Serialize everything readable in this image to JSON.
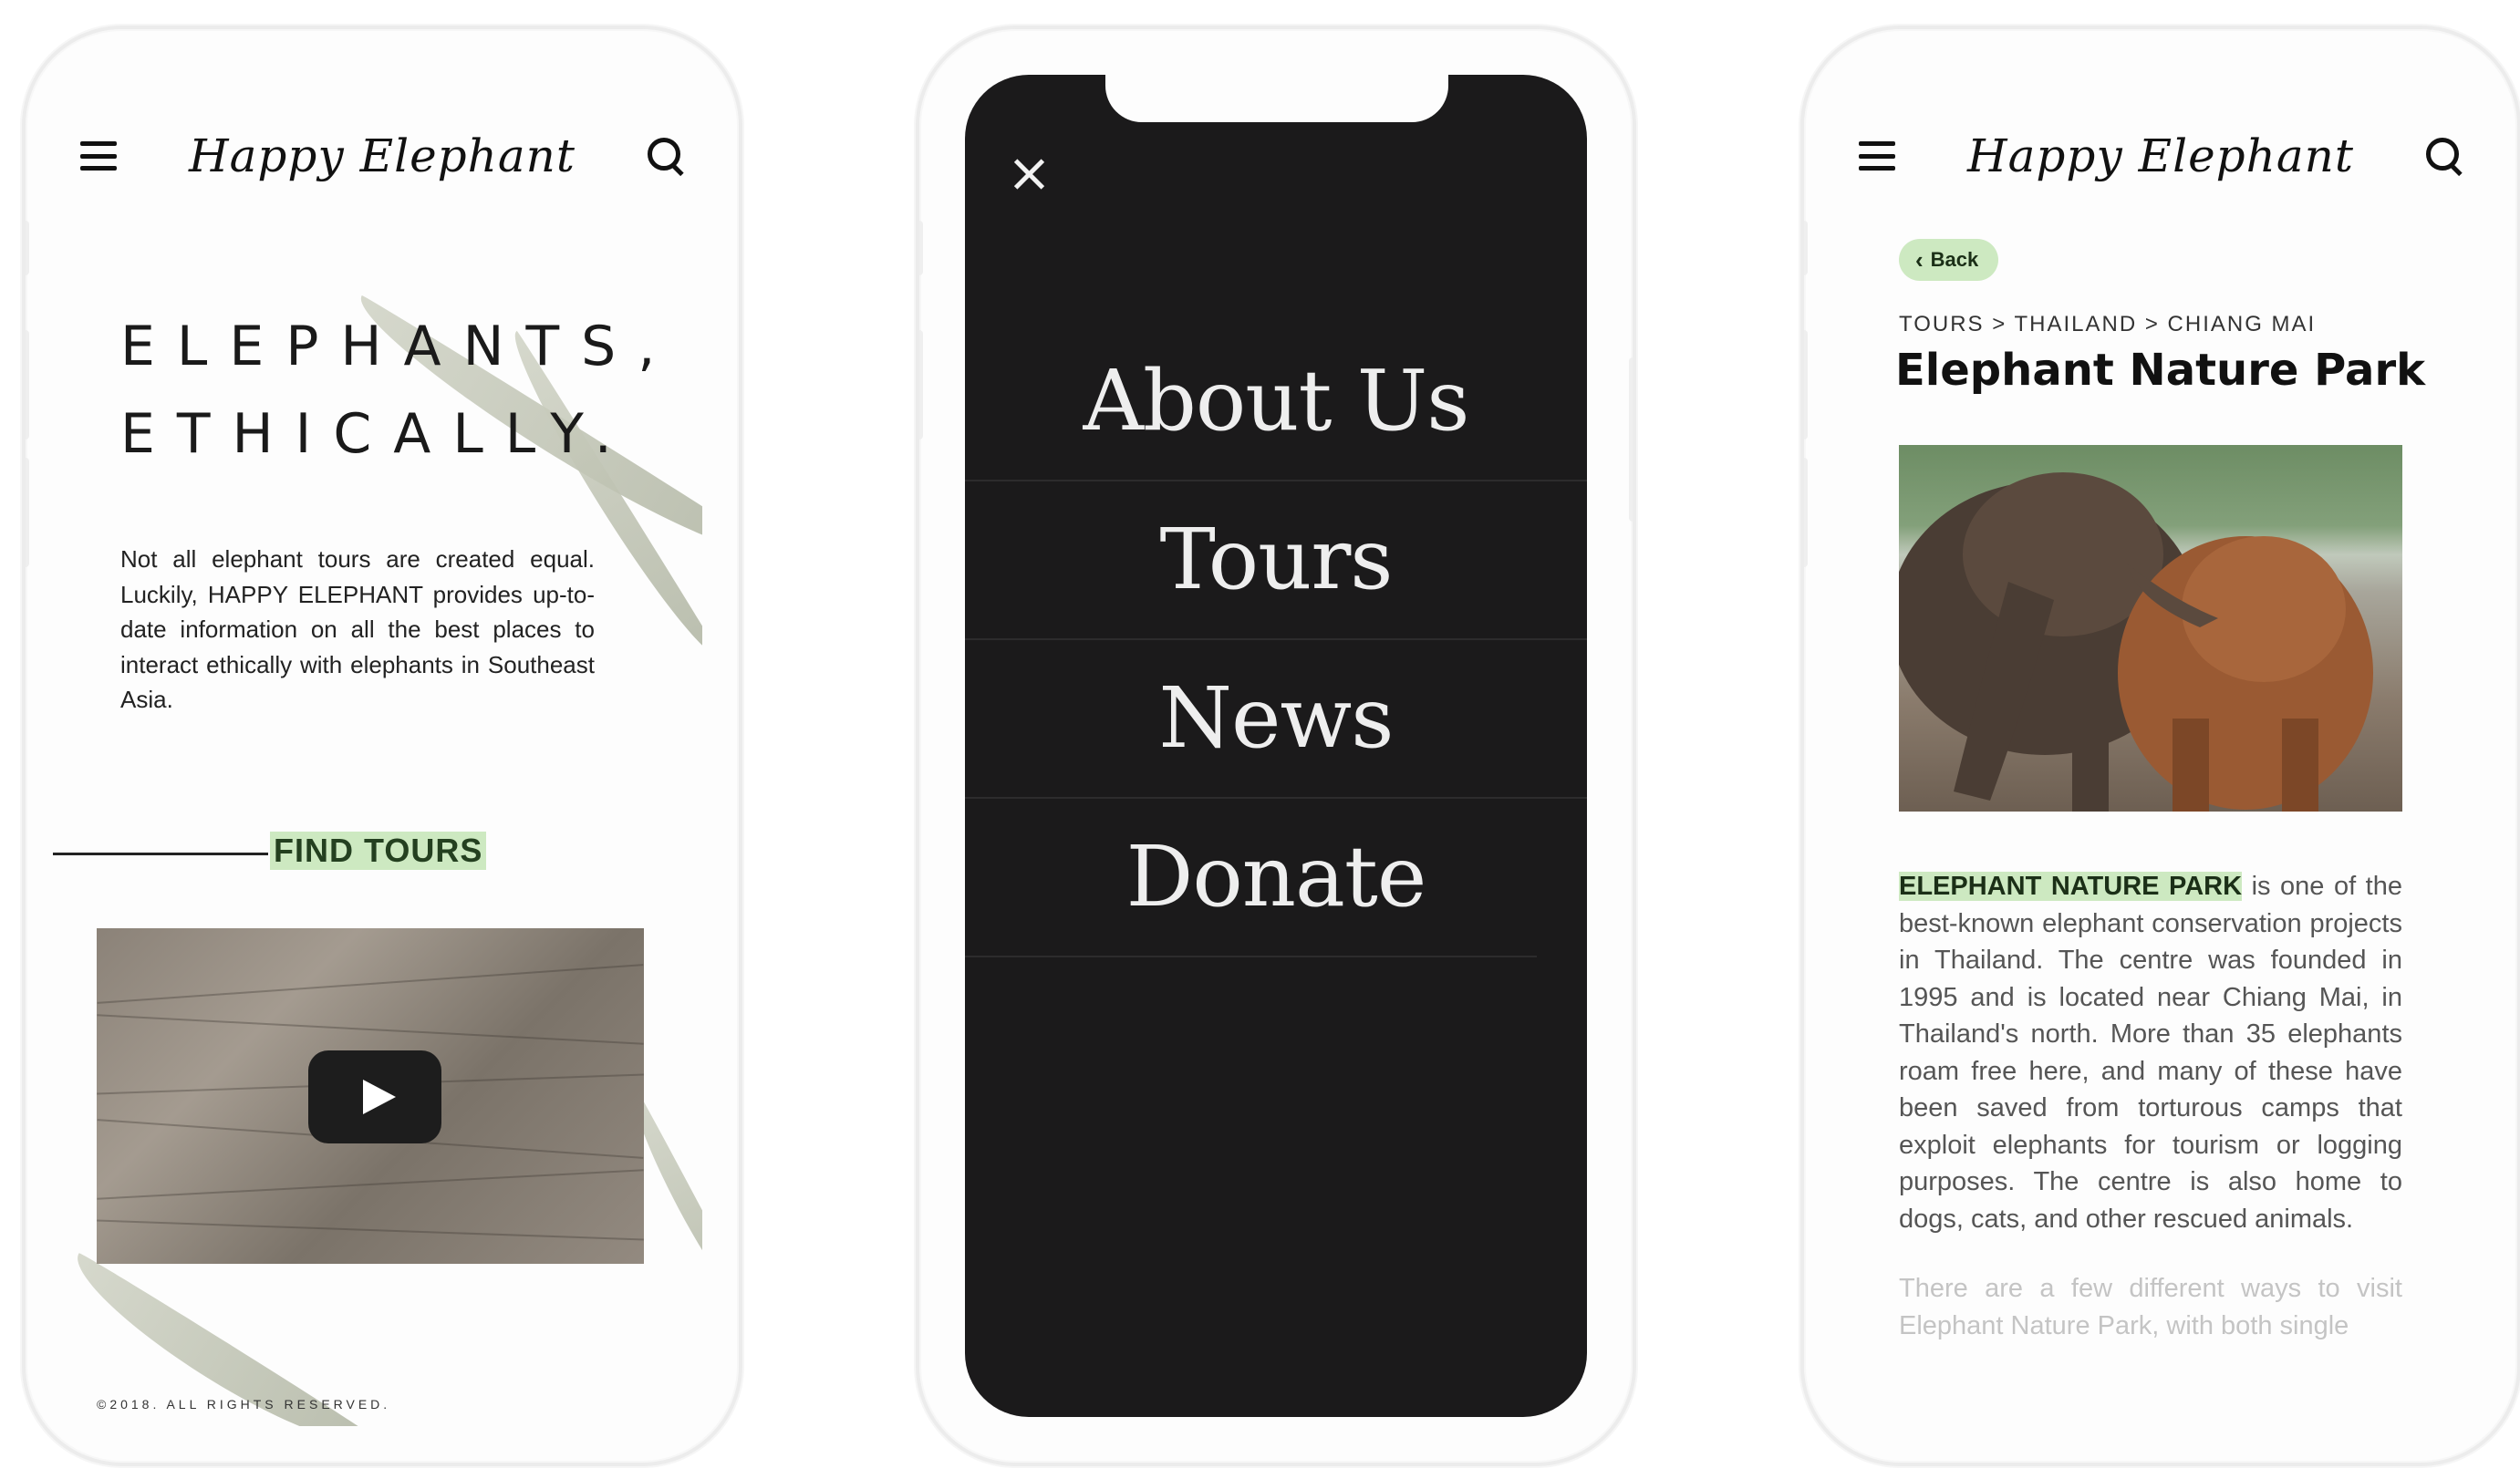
{
  "phone_home": {
    "logo": "Happy Elephant",
    "hero_title_line1": "ELEPHANTS,",
    "hero_title_line2": "ETHICALLY.",
    "intro": "Not all elephant tours are created equal. Luckily, HAPPY ELEPHANT provides up-to-date information on all the best places to interact ethically with elephants in Southeast Asia.",
    "cta_label": "FIND TOURS",
    "copyright": "©2018. ALL RIGHTS RESERVED."
  },
  "phone_menu": {
    "items": [
      "About Us",
      "Tours",
      "News",
      "Donate"
    ]
  },
  "phone_detail": {
    "logo": "Happy Elephant",
    "back_label": "Back",
    "breadcrumb": "TOURS > THAILAND > CHIANG MAI",
    "title": "Elephant Nature Park",
    "body_highlight": "ELEPHANT NATURE PARK",
    "body_rest": " is one of the best-known elephant conservation projects in Thailand. The centre was founded in 1995 and is located near Chiang Mai, in Thailand's north. More than 35 elephants roam free here, and many of these have been saved from torturous camps that exploit elephants for tourism or logging purposes. The centre is also home to dogs, cats, and other rescued animals.",
    "body_faded": "There are a few different ways to visit Elephant Nature Park, with both single"
  },
  "colors": {
    "accent_green": "#cde9c1",
    "menu_background": "#1b1a1b"
  }
}
